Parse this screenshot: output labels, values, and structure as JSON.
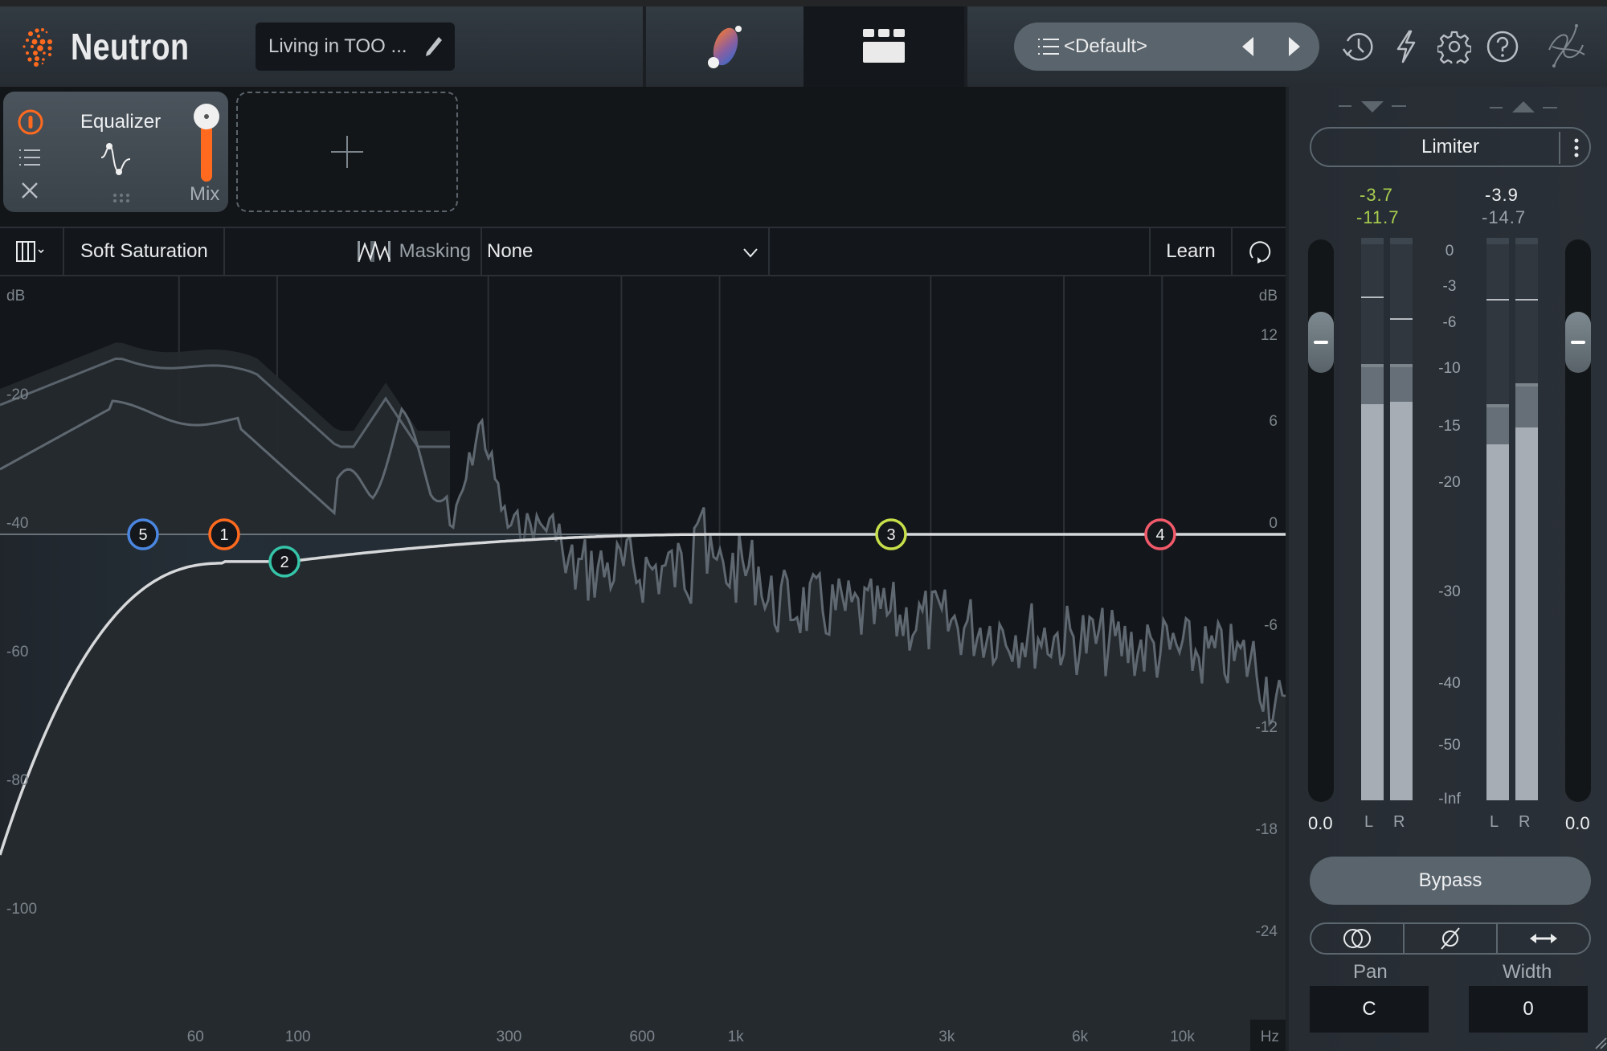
{
  "app": {
    "name": "Neutron",
    "brand_color": "#ff6a1f"
  },
  "header": {
    "track_name": "Living in TOO ...",
    "preset_label": "<Default>",
    "icons": [
      "visual-mixer-icon",
      "assistant-view-icon",
      "preset-list-icon",
      "previous-preset-icon",
      "next-preset-icon",
      "history-icon",
      "lightning-icon",
      "settings-gear-icon",
      "help-icon",
      "ozone-link-icon"
    ]
  },
  "modules": {
    "items": [
      {
        "title": "Equalizer",
        "mix_label": "Mix",
        "mix_value_fraction": 1.0,
        "enabled": true
      }
    ],
    "add_icon": "plus-icon"
  },
  "eq_toolbar": {
    "mode": "Soft Saturation",
    "masking_label": "Masking",
    "masking_value": "None",
    "learn_label": "Learn"
  },
  "eq_graph": {
    "left_axis_unit": "dB",
    "left_axis_ticks": [
      "-20",
      "-40",
      "-60",
      "-80",
      "-100"
    ],
    "right_axis_unit": "dB",
    "right_axis_ticks": [
      "12",
      "6",
      "0",
      "-6",
      "-12",
      "-18",
      "-24"
    ],
    "freq_unit": "Hz",
    "freq_ticks": [
      "60",
      "100",
      "300",
      "600",
      "1k",
      "3k",
      "6k",
      "10k"
    ],
    "bands": [
      {
        "id": "1",
        "color": "#ff6a1f",
        "freq": "~100 Hz",
        "gain_db": 0
      },
      {
        "id": "2",
        "color": "#35c4a8",
        "freq": "~150 Hz",
        "gain_db": -2.5
      },
      {
        "id": "3",
        "color": "#c7e04a",
        "freq": "~2.5 kHz",
        "gain_db": 0
      },
      {
        "id": "4",
        "color": "#f25a6b",
        "freq": "~9.5 kHz",
        "gain_db": 0
      },
      {
        "id": "5",
        "color": "#4a86e0",
        "freq": "~55 Hz",
        "gain_db": 0
      }
    ]
  },
  "meters": {
    "dynamics_label": "Limiter",
    "input_peak": "-3.7",
    "input_rms": "-11.7",
    "output_peak": "-3.9",
    "output_rms": "-14.7",
    "input_gain": "0.0",
    "output_gain": "0.0",
    "scale": [
      "0",
      "-3",
      "-6",
      "-10",
      "-15",
      "-20",
      "-30",
      "-40",
      "-50",
      "-Inf"
    ],
    "channel_labels": [
      "L",
      "R",
      "L",
      "R"
    ],
    "levels_db": {
      "in_L": {
        "peak_hold": -3.7,
        "peak": -9.5,
        "rms": -13.0
      },
      "in_R": {
        "peak_hold": -5.5,
        "peak": -9.5,
        "rms": -12.8
      },
      "out_L": {
        "peak_hold": -3.9,
        "peak": -13.0,
        "rms": -16.5
      },
      "out_R": {
        "peak_hold": -3.9,
        "peak": -11.2,
        "rms": -15.0
      }
    },
    "peak_color": "#a9cf4f",
    "bypass_label": "Bypass",
    "pan_label": "Pan",
    "pan_value": "C",
    "width_label": "Width",
    "width_value": "0"
  }
}
